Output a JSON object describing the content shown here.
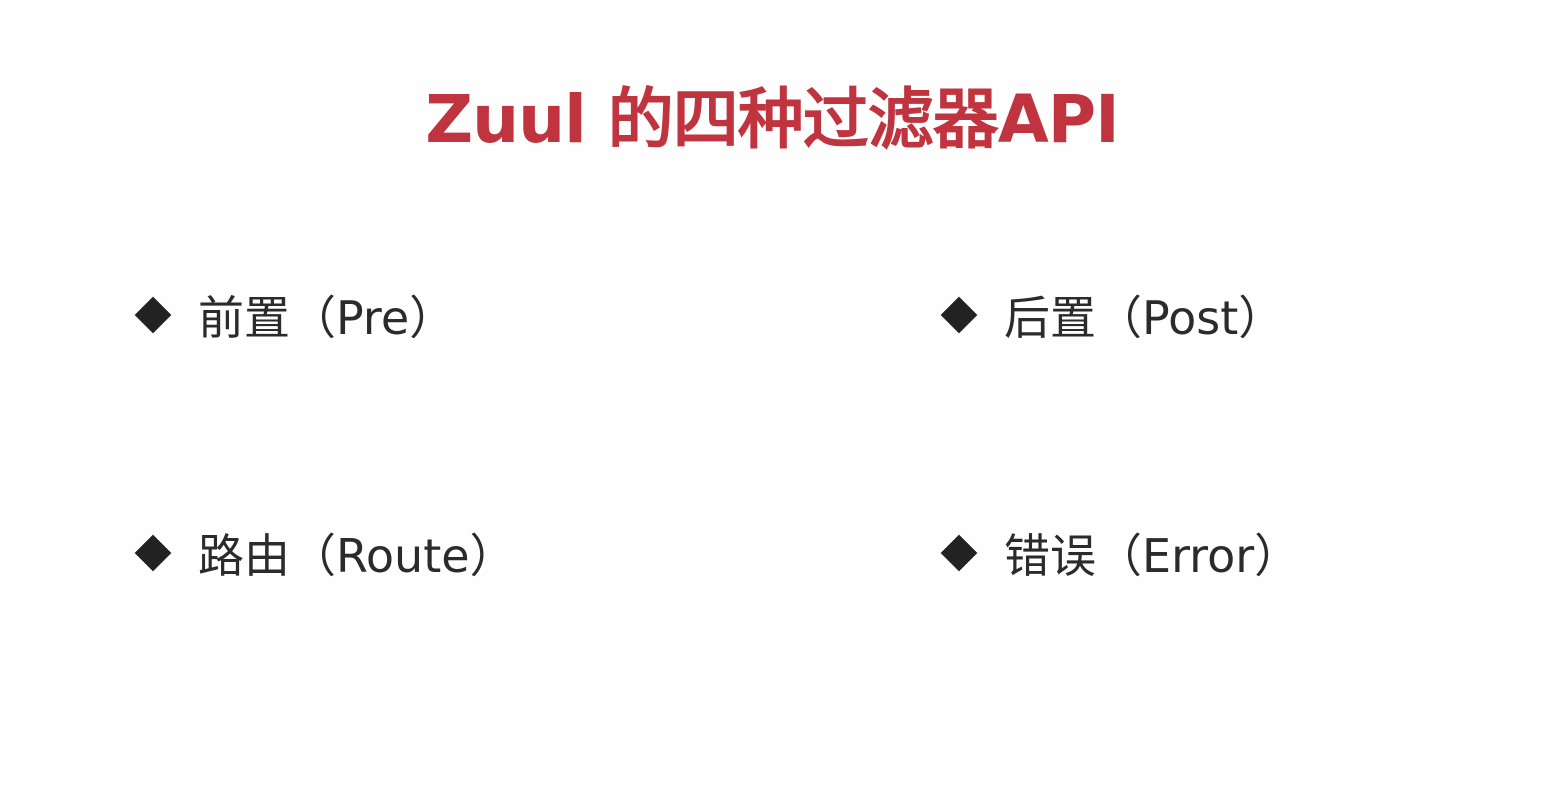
{
  "slide": {
    "title": "Zuul 的四种过滤器API",
    "items": [
      {
        "label": "前置（Pre）",
        "icon": "diamond-bullet-icon"
      },
      {
        "label": "后置（Post）",
        "icon": "diamond-bullet-icon"
      },
      {
        "label": "路由（Route）",
        "icon": "diamond-bullet-icon"
      },
      {
        "label": "错误（Error）",
        "icon": "diamond-bullet-icon"
      }
    ]
  },
  "colors": {
    "title": "#c0343f",
    "text": "#2b2b2b",
    "bullet": "#222222",
    "background": "#fefefe"
  }
}
